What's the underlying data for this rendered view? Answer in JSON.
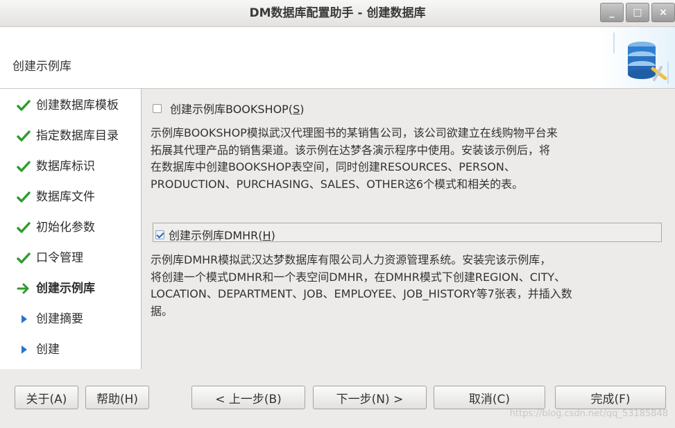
{
  "window": {
    "title": "DM数据库配置助手 - 创建数据库",
    "controls": {
      "minimize": "_",
      "maximize": "□",
      "close": "×"
    }
  },
  "header": {
    "title": "创建示例库",
    "logo_icon": "database-tools-icon"
  },
  "steps": [
    {
      "label": "创建数据库模板",
      "status": "done"
    },
    {
      "label": "指定数据库目录",
      "status": "done"
    },
    {
      "label": "数据库标识",
      "status": "done"
    },
    {
      "label": "数据库文件",
      "status": "done"
    },
    {
      "label": "初始化参数",
      "status": "done"
    },
    {
      "label": "口令管理",
      "status": "done"
    },
    {
      "label": "创建示例库",
      "status": "current"
    },
    {
      "label": "创建摘要",
      "status": "pending"
    },
    {
      "label": "创建",
      "status": "pending"
    }
  ],
  "bookshop": {
    "label_prefix": "创建示例库BOOKSHOP(",
    "mnemonic": "S",
    "label_suffix": ")",
    "checked": false,
    "description": "示例库BOOKSHOP模拟武汉代理图书的某销售公司，该公司欲建立在线购物平台来\n拓展其代理产品的销售渠道。该示例在达梦各演示程序中使用。安装该示例后，将\n在数据库中创建BOOKSHOP表空间，同时创建RESOURCES、PERSON、\nPRODUCTION、PURCHASING、SALES、OTHER这6个模式和相关的表。"
  },
  "dmhr": {
    "label_prefix": "创建示例库DMHR(",
    "mnemonic": "H",
    "label_suffix": ")",
    "checked": true,
    "description": "示例库DMHR模拟武汉达梦数据库有限公司人力资源管理系统。安装完该示例库，\n将创建一个模式DMHR和一个表空间DMHR，在DMHR模式下创建REGION、CITY、\nLOCATION、DEPARTMENT、JOB、EMPLOYEE、JOB_HISTORY等7张表，并插入数\n据。"
  },
  "buttons": {
    "about": "关于(A)",
    "help": "帮助(H)",
    "back": "< 上一步(B)",
    "next": "下一步(N) >",
    "cancel": "取消(C)",
    "finish": "完成(F)"
  },
  "watermark": "https://blog.csdn.net/qq_53185848",
  "colors": {
    "check": "#2e9c2e",
    "arrow": "#2e9c2e",
    "pending_triangle": "#2b73c9"
  }
}
